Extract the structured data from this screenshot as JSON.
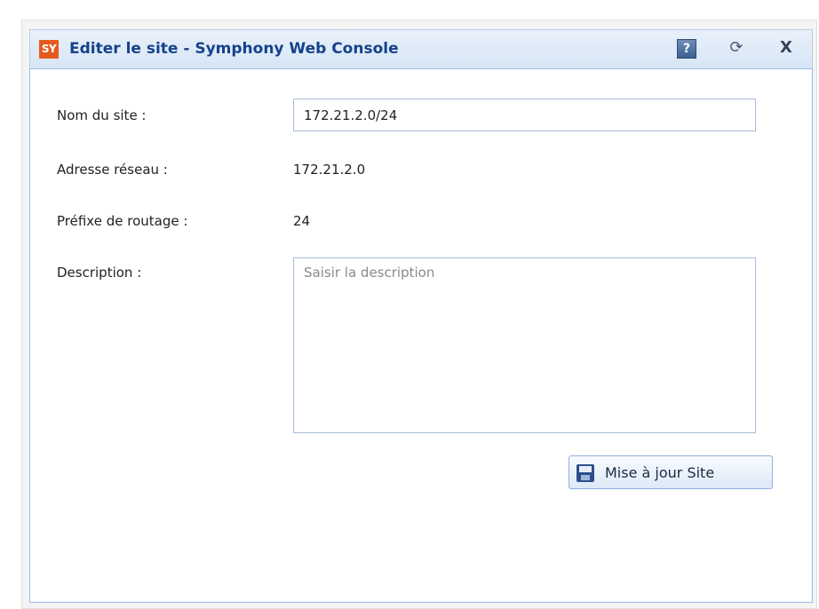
{
  "dialog": {
    "logo_text": "SY",
    "title": "Editer le site - Symphony Web Console",
    "help_icon_glyph": "?",
    "refresh_icon_glyph": "⟳",
    "close_icon_glyph": "X"
  },
  "form": {
    "site_name_label": "Nom du site :",
    "site_name_value": "172.21.2.0/24",
    "network_address_label": "Adresse réseau :",
    "network_address_value": "172.21.2.0",
    "routing_prefix_label": "Préfixe de routage :",
    "routing_prefix_value": "24",
    "description_label": "Description :",
    "description_value": "",
    "description_placeholder": "Saisir la description",
    "update_button_label": "Mise à jour Site"
  },
  "colors": {
    "title_text": "#15428b",
    "logo_bg": "#e35b1e",
    "input_border": "#a8bcd8",
    "panel_border": "#99bbe8"
  }
}
